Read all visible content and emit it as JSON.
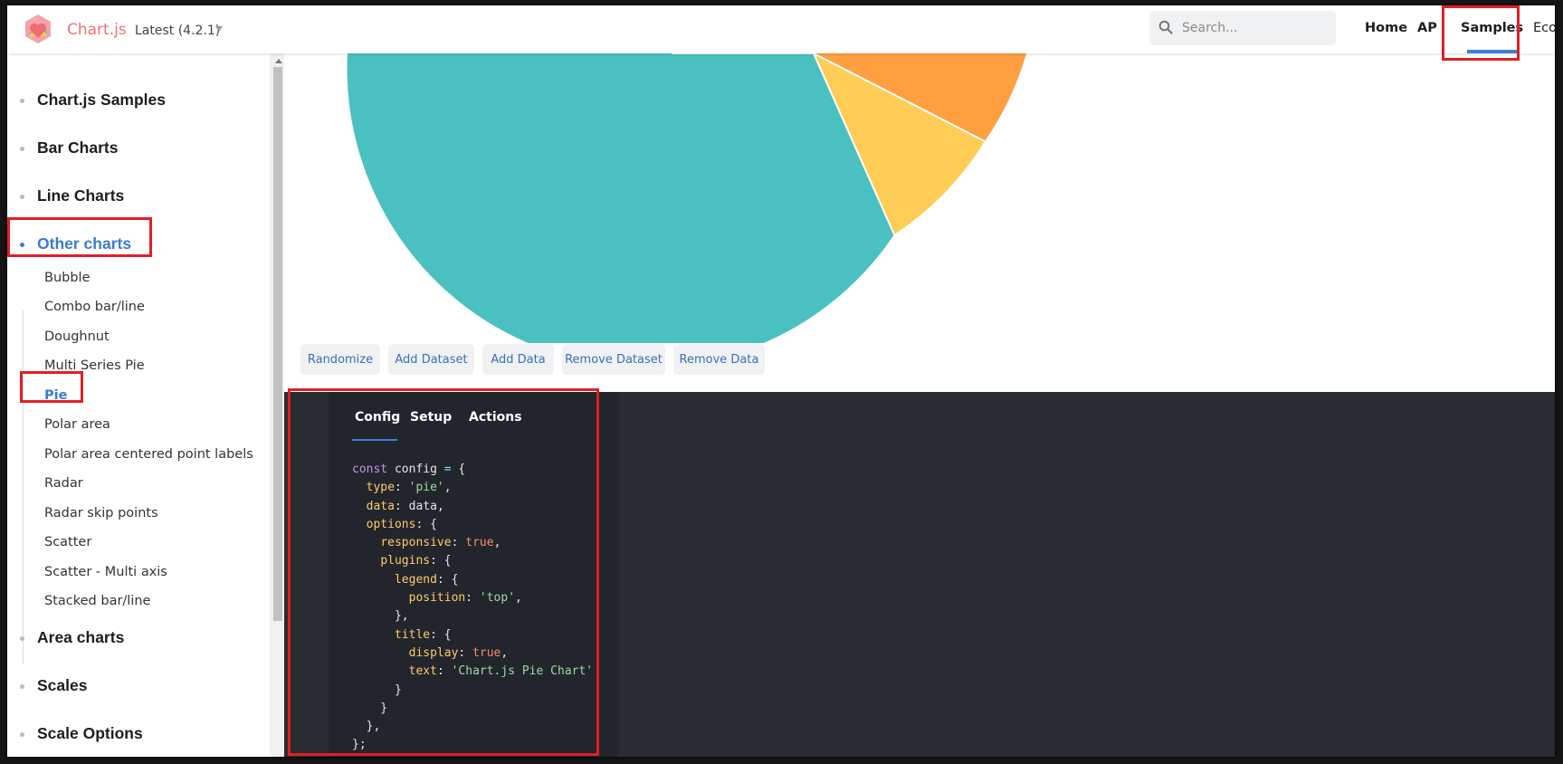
{
  "navbar": {
    "brand": "Chart.js",
    "version": "Latest (4.2.1)",
    "search_placeholder": "Search...",
    "links": [
      "Home",
      "AP",
      "Samples",
      "Ecos"
    ],
    "active_link": "Samples"
  },
  "sidebar": {
    "categories": [
      {
        "label": "Chart.js Samples"
      },
      {
        "label": "Bar Charts"
      },
      {
        "label": "Line Charts"
      },
      {
        "label": "Other charts",
        "active": true
      },
      {
        "label": "Area charts"
      },
      {
        "label": "Scales"
      },
      {
        "label": "Scale Options"
      }
    ],
    "other_charts_items": [
      "Bubble",
      "Combo bar/line",
      "Doughnut",
      "Multi Series Pie",
      "Pie",
      "Polar area",
      "Polar area centered point labels",
      "Radar",
      "Radar skip points",
      "Scatter",
      "Scatter - Multi axis",
      "Stacked bar/line"
    ],
    "active_item": "Pie"
  },
  "chart_colors": {
    "teal": "#4bc0c0",
    "yellow": "#ffcd56",
    "orange": "#ff9f40"
  },
  "actions": {
    "randomize": "Randomize",
    "add_dataset": "Add Dataset",
    "add_data": "Add Data",
    "remove_dataset": "Remove Dataset",
    "remove_data": "Remove Data"
  },
  "code_tabs": {
    "config": "Config",
    "setup": "Setup",
    "actions": "Actions",
    "active": "Config"
  },
  "code_text": {
    "const": "const",
    "config": "config",
    "type": "type",
    "pie": "'pie'",
    "data_key": "data",
    "data_val": "data",
    "options": "options",
    "responsive": "responsive",
    "true1": "true",
    "plugins": "plugins",
    "legend": "legend",
    "position": "position",
    "top": "'top'",
    "title": "title",
    "display": "display",
    "true2": "true",
    "text": "text",
    "title_str": "'Chart.js Pie Chart'"
  }
}
